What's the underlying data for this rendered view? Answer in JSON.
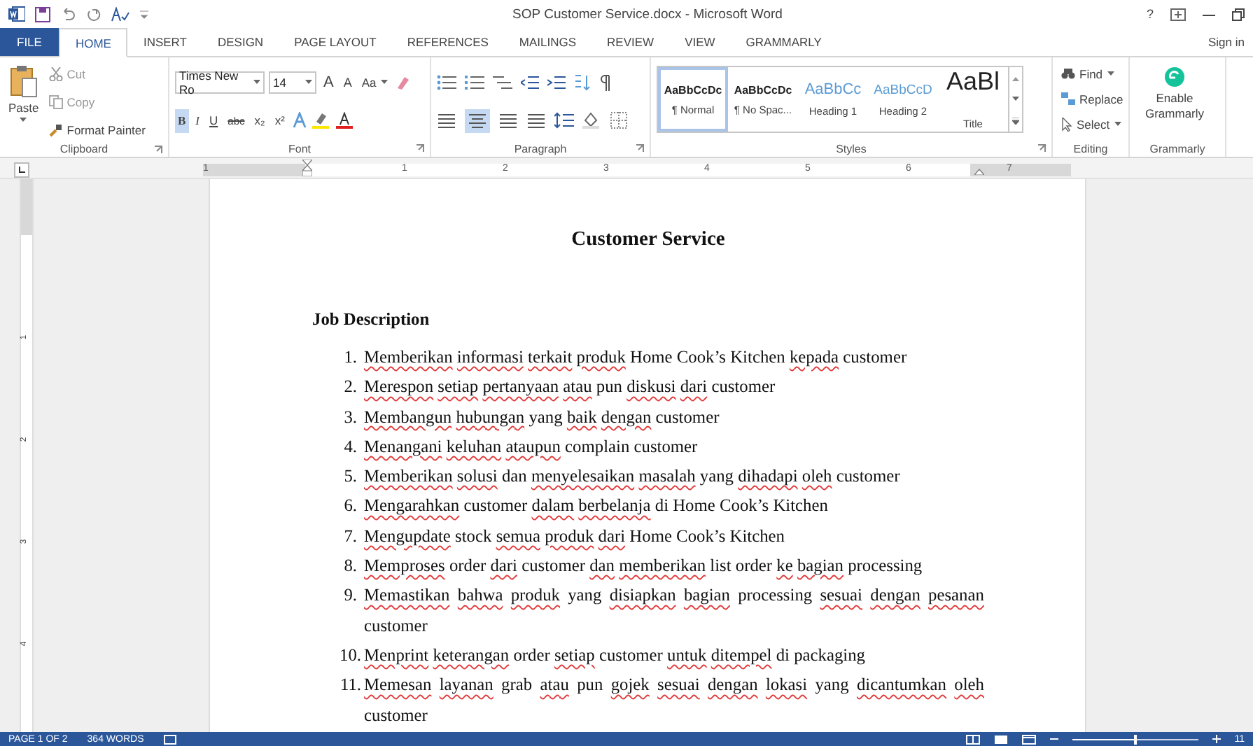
{
  "window": {
    "title": "SOP Customer Service.docx - Microsoft Word",
    "help": "?"
  },
  "tabs": [
    {
      "label": "FILE",
      "kind": "file",
      "selected": false
    },
    {
      "label": "HOME",
      "kind": "tab",
      "selected": true
    },
    {
      "label": "INSERT",
      "kind": "tab",
      "selected": false
    },
    {
      "label": "DESIGN",
      "kind": "tab",
      "selected": false
    },
    {
      "label": "PAGE LAYOUT",
      "kind": "tab",
      "selected": false
    },
    {
      "label": "REFERENCES",
      "kind": "tab",
      "selected": false
    },
    {
      "label": "MAILINGS",
      "kind": "tab",
      "selected": false
    },
    {
      "label": "REVIEW",
      "kind": "tab",
      "selected": false
    },
    {
      "label": "VIEW",
      "kind": "tab",
      "selected": false
    },
    {
      "label": "GRAMMARLY",
      "kind": "tab",
      "selected": false
    }
  ],
  "sign_in": "Sign in",
  "clipboard": {
    "paste": "Paste",
    "cut": "Cut",
    "copy": "Copy",
    "format_painter": "Format Painter",
    "label": "Clipboard"
  },
  "font": {
    "name": "Times New Ro",
    "size": "14",
    "grow": "A",
    "shrink": "A",
    "change_case": "Aa",
    "bold": "B",
    "italic": "I",
    "underline": "U",
    "strike": "abc",
    "subscript": "x₂",
    "superscript": "x²",
    "bold_on": true,
    "label": "Font"
  },
  "paragraph": {
    "align_center_on": true,
    "label": "Paragraph"
  },
  "styles": {
    "items": [
      {
        "preview": "AaBbCcDc",
        "name": "¶ Normal",
        "kind": "normal",
        "selected": true
      },
      {
        "preview": "AaBbCcDc",
        "name": "¶ No Spac...",
        "kind": "normal",
        "selected": false
      },
      {
        "preview": "AaBbCc",
        "name": "Heading 1",
        "kind": "heading1",
        "selected": false
      },
      {
        "preview": "AaBbCcD",
        "name": "Heading 2",
        "kind": "heading2",
        "selected": false
      },
      {
        "preview": "AaBl",
        "name": "Title",
        "kind": "title",
        "selected": false
      }
    ],
    "label": "Styles"
  },
  "editing": {
    "find": "Find",
    "replace": "Replace",
    "select": "Select",
    "label": "Editing"
  },
  "grammarly": {
    "button": "Enable Grammarly",
    "label": "Grammarly"
  },
  "ruler": {
    "labels": [
      "1",
      "1",
      "2",
      "3",
      "4",
      "5",
      "6",
      "7"
    ]
  },
  "vertical_ruler": {
    "labels": [
      "1",
      "2",
      "3",
      "4"
    ]
  },
  "document": {
    "title": "Customer Service",
    "heading": "Job Description",
    "items": [
      {
        "number": "1.",
        "segments": [
          {
            "text": "Memberikan",
            "misspelled": true
          },
          {
            "text": "informasi",
            "misspelled": true
          },
          {
            "text": "terkait",
            "misspelled": true
          },
          {
            "text": "produk",
            "misspelled": true
          },
          {
            "text": "Home Cook’s Kitchen",
            "misspelled": false
          },
          {
            "text": "kepada",
            "misspelled": true
          },
          {
            "text": "customer",
            "misspelled": false
          }
        ]
      },
      {
        "number": "2.",
        "segments": [
          {
            "text": "Merespon",
            "misspelled": true
          },
          {
            "text": "setiap",
            "misspelled": true
          },
          {
            "text": "pertanyaan",
            "misspelled": true
          },
          {
            "text": "atau",
            "misspelled": true
          },
          {
            "text": "pun",
            "misspelled": false
          },
          {
            "text": "diskusi",
            "misspelled": true
          },
          {
            "text": "dari",
            "misspelled": true
          },
          {
            "text": "customer",
            "misspelled": false
          }
        ]
      },
      {
        "number": "3.",
        "segments": [
          {
            "text": "Membangun",
            "misspelled": true
          },
          {
            "text": "hubungan",
            "misspelled": true
          },
          {
            "text": "yang",
            "misspelled": false
          },
          {
            "text": "baik",
            "misspelled": true
          },
          {
            "text": "dengan",
            "misspelled": true
          },
          {
            "text": "customer",
            "misspelled": false
          }
        ]
      },
      {
        "number": "4.",
        "segments": [
          {
            "text": "Menangani",
            "misspelled": true
          },
          {
            "text": "keluhan",
            "misspelled": true
          },
          {
            "text": "ataupun",
            "misspelled": true
          },
          {
            "text": "complain customer",
            "misspelled": false
          }
        ]
      },
      {
        "number": "5.",
        "segments": [
          {
            "text": "Memberikan",
            "misspelled": true
          },
          {
            "text": "solusi",
            "misspelled": true
          },
          {
            "text": "dan",
            "misspelled": false
          },
          {
            "text": "menyelesaikan",
            "misspelled": true
          },
          {
            "text": "masalah",
            "misspelled": true
          },
          {
            "text": "yang",
            "misspelled": false
          },
          {
            "text": "dihadapi",
            "misspelled": true
          },
          {
            "text": "oleh",
            "misspelled": true
          },
          {
            "text": "customer",
            "misspelled": false
          }
        ]
      },
      {
        "number": "6.",
        "segments": [
          {
            "text": "Mengarahkan",
            "misspelled": true
          },
          {
            "text": "customer",
            "misspelled": false
          },
          {
            "text": "dalam",
            "misspelled": true
          },
          {
            "text": "berbelanja",
            "misspelled": true
          },
          {
            "text": "di Home Cook’s Kitchen",
            "misspelled": false
          }
        ]
      },
      {
        "number": "7.",
        "segments": [
          {
            "text": "Mengupdate",
            "misspelled": true
          },
          {
            "text": "stock",
            "misspelled": false
          },
          {
            "text": "semua",
            "misspelled": true
          },
          {
            "text": "produk",
            "misspelled": true
          },
          {
            "text": "dari",
            "misspelled": true
          },
          {
            "text": "Home Cook’s Kitchen",
            "misspelled": false
          }
        ]
      },
      {
        "number": "8.",
        "segments": [
          {
            "text": "Memproses",
            "misspelled": true
          },
          {
            "text": "order",
            "misspelled": false
          },
          {
            "text": "dari",
            "misspelled": true
          },
          {
            "text": "customer",
            "misspelled": false
          },
          {
            "text": "dan",
            "misspelled": true
          },
          {
            "text": "memberikan",
            "misspelled": true
          },
          {
            "text": "list order",
            "misspelled": false
          },
          {
            "text": "ke",
            "misspelled": true
          },
          {
            "text": "bagian",
            "misspelled": true
          },
          {
            "text": "processing",
            "misspelled": false
          }
        ]
      },
      {
        "number": "9.",
        "segments": [
          {
            "text": "Memastikan",
            "misspelled": true
          },
          {
            "text": "bahwa",
            "misspelled": true
          },
          {
            "text": "produk",
            "misspelled": true
          },
          {
            "text": "yang",
            "misspelled": false
          },
          {
            "text": "disiapkan",
            "misspelled": true
          },
          {
            "text": "bagian",
            "misspelled": true
          },
          {
            "text": "processing",
            "misspelled": false
          },
          {
            "text": "sesuai",
            "misspelled": true
          },
          {
            "text": "dengan",
            "misspelled": true
          },
          {
            "text": "pesanan",
            "misspelled": true
          },
          {
            "text": "customer",
            "misspelled": false
          }
        ]
      },
      {
        "number": "10.",
        "segments": [
          {
            "text": "Menprint",
            "misspelled": true
          },
          {
            "text": "keterangan",
            "misspelled": true
          },
          {
            "text": "order",
            "misspelled": false
          },
          {
            "text": "setiap",
            "misspelled": true
          },
          {
            "text": "customer",
            "misspelled": false
          },
          {
            "text": "untuk",
            "misspelled": true
          },
          {
            "text": "ditempel",
            "misspelled": true
          },
          {
            "text": "di packaging",
            "misspelled": false
          }
        ]
      },
      {
        "number": "11.",
        "segments": [
          {
            "text": "Memesan",
            "misspelled": true
          },
          {
            "text": "layanan",
            "misspelled": true
          },
          {
            "text": "grab",
            "misspelled": false
          },
          {
            "text": "atau",
            "misspelled": true
          },
          {
            "text": "pun",
            "misspelled": false
          },
          {
            "text": "gojek",
            "misspelled": true
          },
          {
            "text": "sesuai",
            "misspelled": true
          },
          {
            "text": "dengan",
            "misspelled": true
          },
          {
            "text": "lokasi",
            "misspelled": true
          },
          {
            "text": "yang",
            "misspelled": false
          },
          {
            "text": "dicantumkan",
            "misspelled": true
          },
          {
            "text": "oleh",
            "misspelled": true
          },
          {
            "text": "customer",
            "misspelled": false
          }
        ]
      }
    ]
  },
  "status_bar": {
    "page": "PAGE 1 OF 2",
    "words": "364 WORDS",
    "level": 0.5,
    "zoom": "11"
  }
}
